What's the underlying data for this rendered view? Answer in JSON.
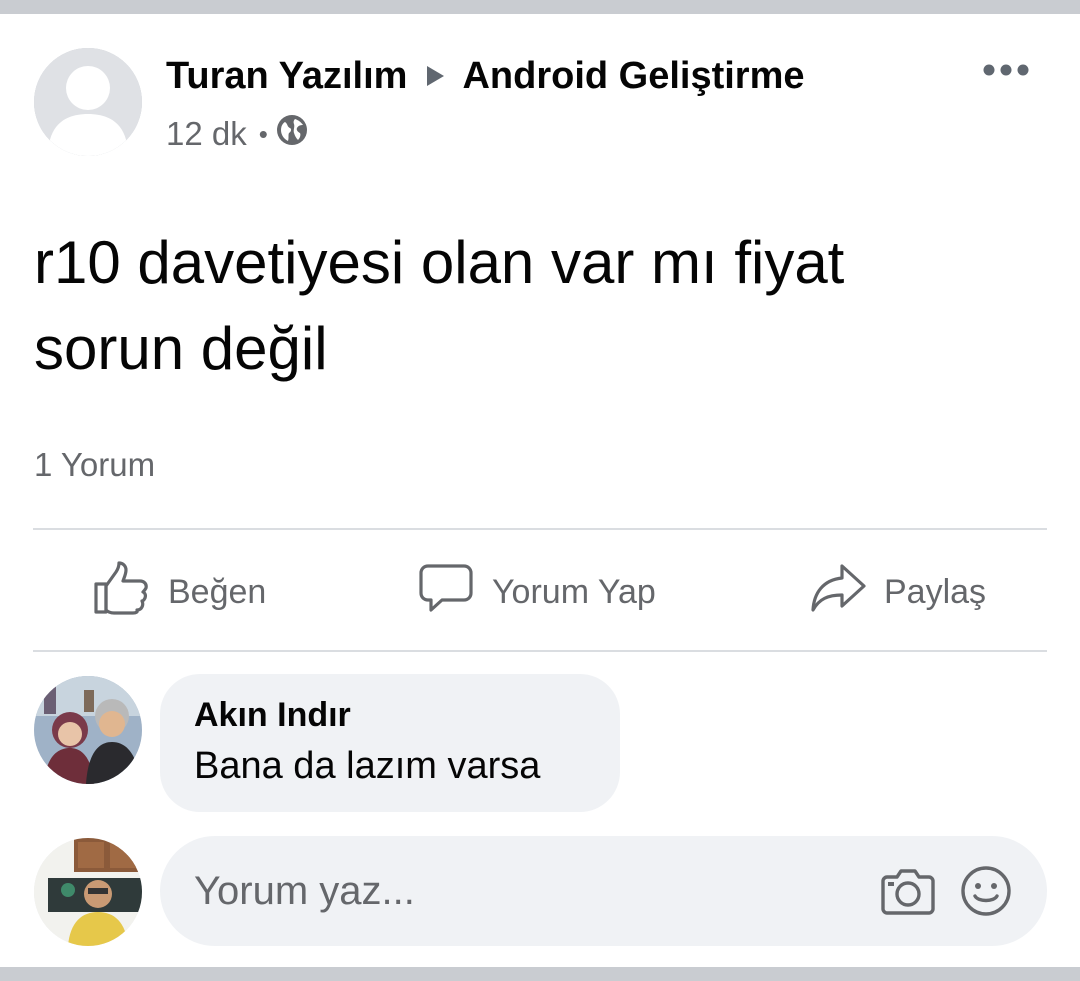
{
  "post": {
    "author": "Turan Yazılım",
    "group": "Android Geliştirme",
    "time": "12 dk",
    "separator": "•",
    "privacy_icon": "globe-icon",
    "text_line1": "r10 davetiyesi olan var mı fiyat",
    "text_line2": "sorun değil",
    "comment_count": "1 Yorum"
  },
  "actions": {
    "like_label": "Beğen",
    "comment_label": "Yorum Yap",
    "share_label": "Paylaş"
  },
  "comment": {
    "author": "Akın Indır",
    "text": "Bana da lazım varsa"
  },
  "composer": {
    "placeholder": "Yorum yaz...",
    "camera_icon": "camera-icon",
    "emoji_icon": "emoji-icon"
  },
  "colors": {
    "text_primary": "#050505",
    "text_secondary": "#65676b",
    "bubble_bg": "#f0f2f5",
    "divider": "#dadde1"
  }
}
